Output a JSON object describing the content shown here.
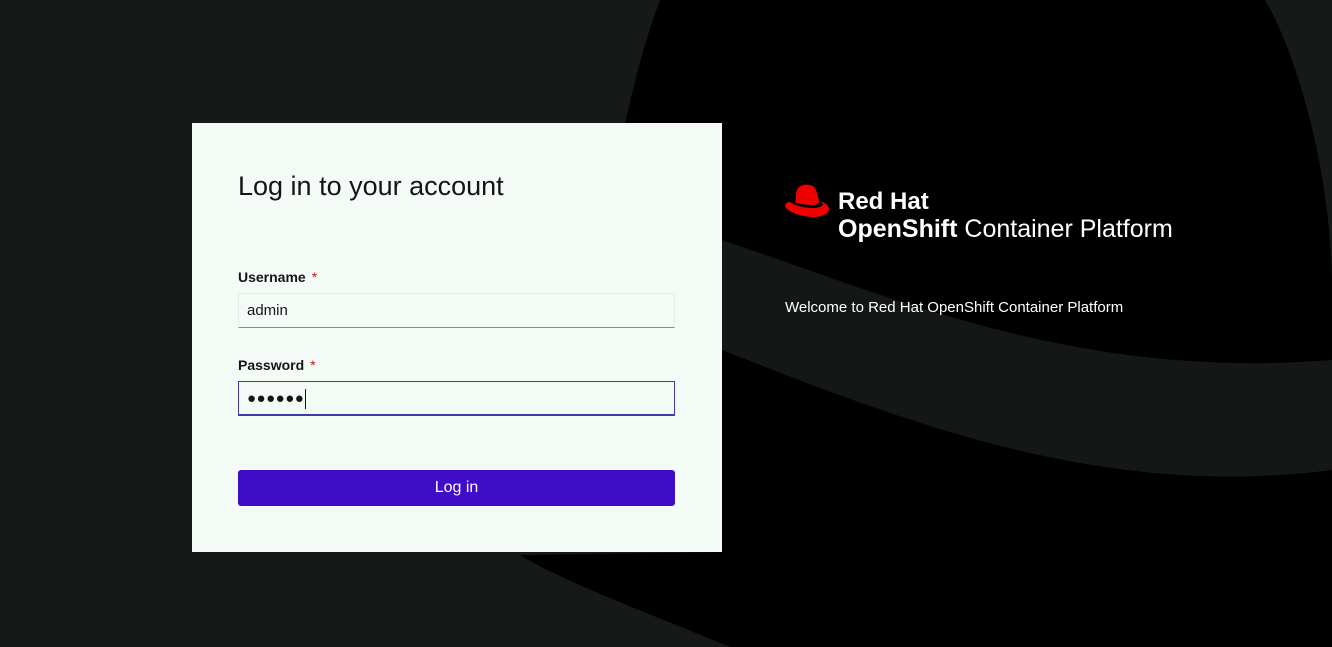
{
  "login_card": {
    "title": "Log in to your account",
    "username": {
      "label": "Username",
      "required_marker": "*",
      "value": "admin"
    },
    "password": {
      "label": "Password",
      "required_marker": "*",
      "masked_value": "●●●●●●"
    },
    "submit_label": "Log in"
  },
  "branding": {
    "company": "Red Hat",
    "product_bold": "OpenShift",
    "product_rest": " Container Platform",
    "welcome_text": "Welcome to Red Hat OpenShift Container Platform"
  },
  "colors": {
    "background": "#151a18",
    "background_shape": "#000000",
    "card": "#f4fbf6",
    "primary_button": "#3f0cc8",
    "required": "#c9190b",
    "focus_border": "#3e3aa8",
    "logo_red": "#ee0000"
  },
  "icons": {
    "logo": "red-hat-logo-icon"
  }
}
